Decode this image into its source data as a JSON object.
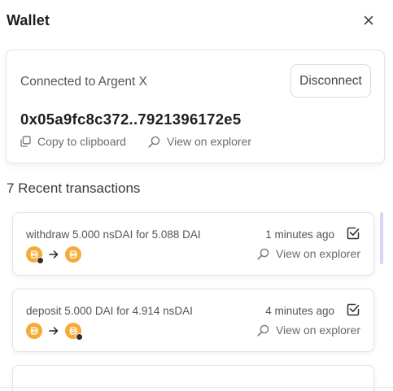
{
  "header": {
    "title": "Wallet"
  },
  "account": {
    "connected_text": "Connected to Argent X",
    "disconnect_label": "Disconnect",
    "address": "0x05a9fc8c372..7921396172e5",
    "copy_label": "Copy to clipboard",
    "view_label": "View on explorer"
  },
  "transactions": {
    "heading": "7 Recent transactions",
    "items": [
      {
        "description": "withdraw 5.000 nsDAI for 5.088 DAI",
        "time": "1 minutes ago",
        "view_label": "View on explorer"
      },
      {
        "description": "deposit 5.000 DAI for 4.914 nsDAI",
        "time": "4 minutes ago",
        "view_label": "View on explorer"
      }
    ]
  },
  "colors": {
    "dai_token": "#f5ac37",
    "card_border": "#e3e3ea",
    "scrollbar": "#d9d4f5"
  }
}
